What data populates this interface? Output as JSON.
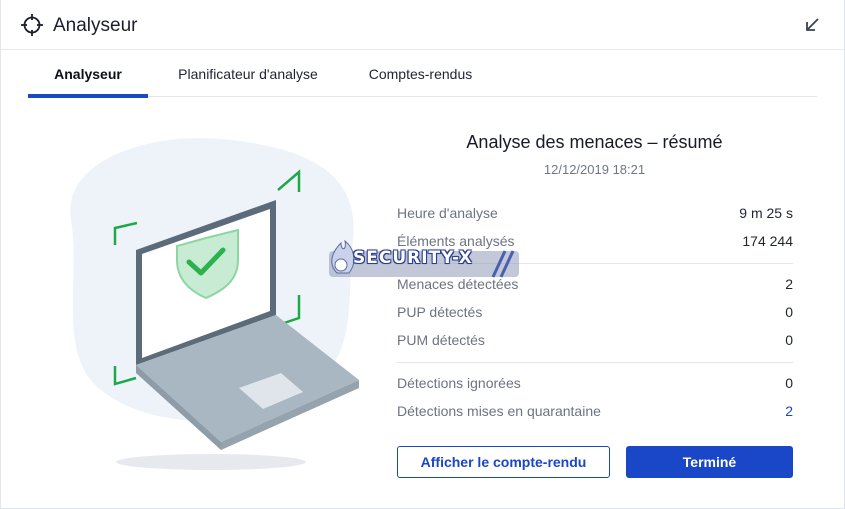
{
  "window": {
    "title": "Analyseur",
    "app_icon": "crosshair-icon",
    "minimize_icon": "arrow-down-left-icon"
  },
  "tabs": [
    {
      "label": "Analyseur",
      "active": true
    },
    {
      "label": "Planificateur d'analyse",
      "active": false
    },
    {
      "label": "Comptes-rendus",
      "active": false
    }
  ],
  "illustration": {
    "icon": "laptop-shield-check-icon"
  },
  "summary": {
    "title": "Analyse des menaces – résumé",
    "date": "12/12/2019 18:21",
    "rows": [
      {
        "label": "Heure d'analyse",
        "value": "9 m 25 s"
      },
      {
        "label": "Éléments analysés",
        "value": "174 244"
      },
      {
        "label": "Menaces détectées",
        "value": "2"
      },
      {
        "label": "PUP détectés",
        "value": "0"
      },
      {
        "label": "PUM détectés",
        "value": "0"
      },
      {
        "label": "Détections ignorées",
        "value": "0"
      },
      {
        "label": "Détections mises en quarantaine",
        "value": "2"
      }
    ]
  },
  "buttons": {
    "view_report": "Afficher le compte-rendu",
    "done": "Terminé"
  },
  "watermark": {
    "text": "SECURITY-X"
  },
  "colors": {
    "accent": "#1a46c8",
    "shield_green": "#2bb24c",
    "frame_green": "#1fa84a",
    "laptop_dark": "#5c6b7a",
    "laptop_light": "#a9b7c2"
  }
}
